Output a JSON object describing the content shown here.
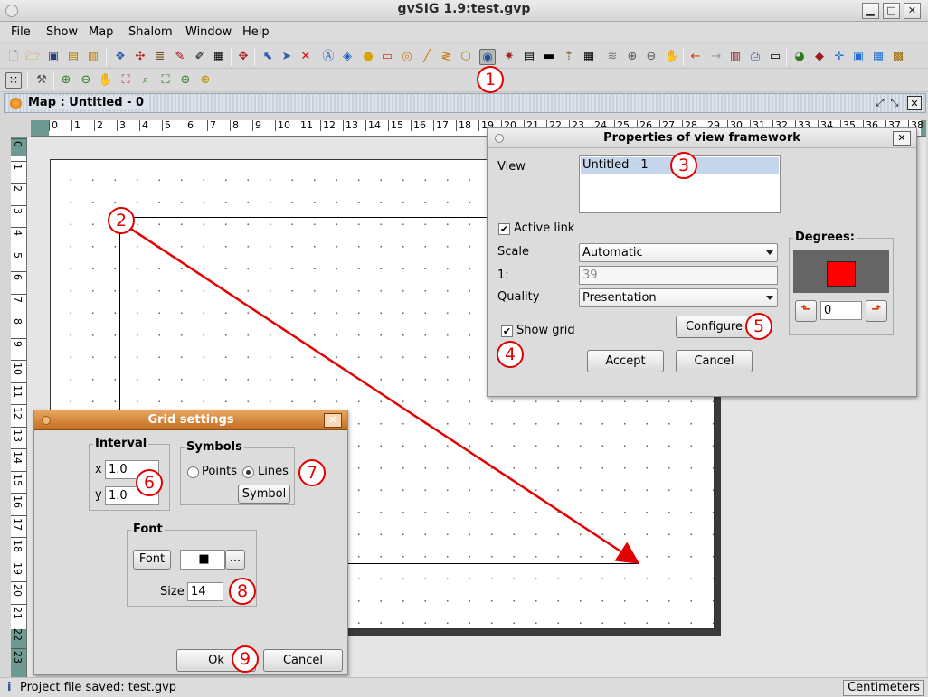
{
  "window": {
    "title": "gvSIG 1.9:test.gvp",
    "minimize_glyph": "▁",
    "maximize_glyph": "□",
    "close_glyph": "✕"
  },
  "menu": [
    "File",
    "Show",
    "Map",
    "Shalom",
    "Window",
    "Help"
  ],
  "map_frame": {
    "title": "Map : Untitled - 0",
    "ruler_top": [
      "0",
      "1",
      "2",
      "3",
      "4",
      "5",
      "6",
      "7",
      "8",
      "9",
      "10",
      "11",
      "12",
      "13",
      "14",
      "15",
      "16",
      "17",
      "18",
      "19",
      "20",
      "21",
      "22",
      "23",
      "24",
      "25",
      "26",
      "27",
      "28",
      "29",
      "30",
      "31",
      "32",
      "33",
      "34",
      "35",
      "36",
      "37",
      "38"
    ],
    "ruler_left": [
      "0",
      "1",
      "2",
      "3",
      "4",
      "5",
      "6",
      "7",
      "8",
      "9",
      "10",
      "11",
      "12",
      "13",
      "14",
      "15",
      "16",
      "17",
      "18",
      "19",
      "20",
      "21",
      "22",
      "23"
    ]
  },
  "properties_dialog": {
    "title": "Properties of view framework",
    "view_label": "View",
    "view_items": [
      "Untitled - 1"
    ],
    "active_link_label": "Active link",
    "active_link_checked": true,
    "scale_label": "Scale",
    "scale_value": "Automatic",
    "ratio_label": "1:",
    "ratio_value": "39",
    "quality_label": "Quality",
    "quality_value": "Presentation",
    "show_grid_label": "Show grid",
    "show_grid_checked": true,
    "configure_label": "Configure",
    "accept_label": "Accept",
    "cancel_label": "Cancel",
    "degrees_label": "Degrees:",
    "degrees_value": "0",
    "preview_color": "#ff0000"
  },
  "grid_dialog": {
    "title": "Grid settings",
    "interval_label": "Interval",
    "x_label": "x",
    "x_value": "1.0",
    "y_label": "y",
    "y_value": "1.0",
    "symbols_label": "Symbols",
    "points_label": "Points",
    "lines_label": "Lines",
    "selected_symbol": "Lines",
    "symbol_button": "Symbol",
    "font_group_label": "Font",
    "font_button": "Font",
    "font_preview": "■",
    "font_more": "...",
    "size_label": "Size",
    "size_value": "14",
    "ok_label": "Ok",
    "cancel_label": "Cancel"
  },
  "callouts": [
    "1",
    "2",
    "3",
    "4",
    "5",
    "6",
    "7",
    "8",
    "9"
  ],
  "status": {
    "icon": "i",
    "message": "Project file saved: test.gvp",
    "units": "Centimeters"
  },
  "colors": {
    "callout": "#e20000",
    "arrow": "#e20000",
    "ruler_teal": "#6d9a93"
  }
}
